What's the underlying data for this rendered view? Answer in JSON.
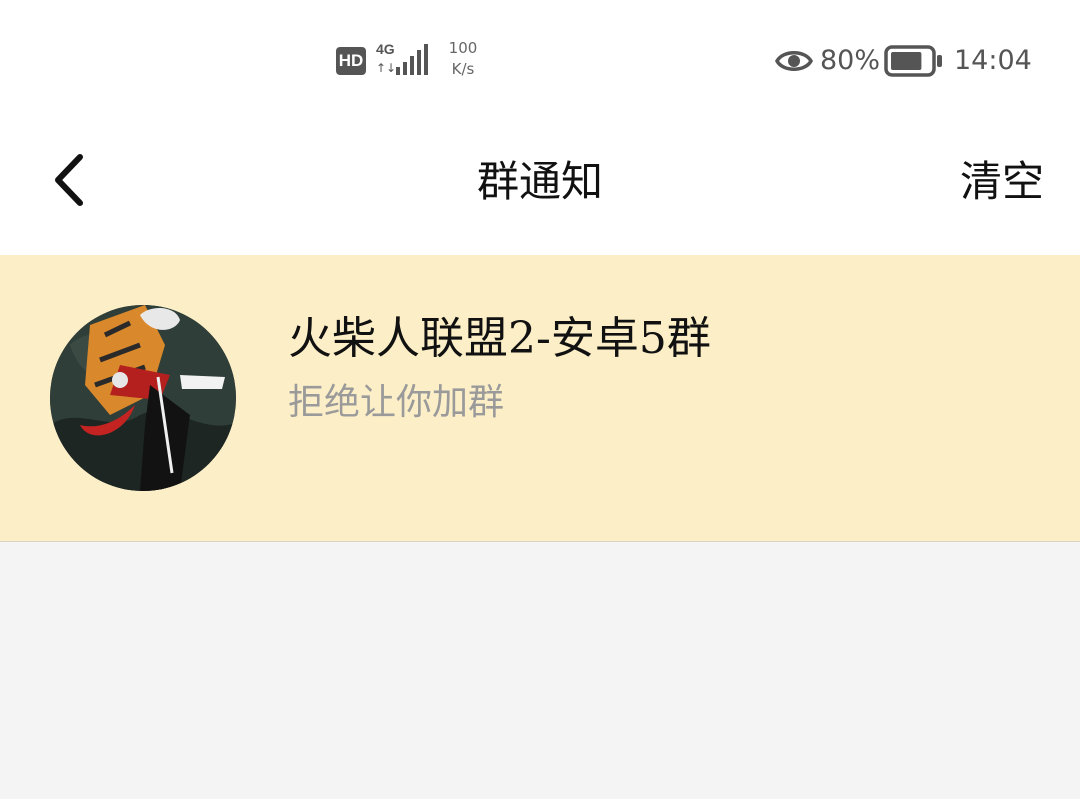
{
  "status_bar": {
    "hd_badge": "HD",
    "network_type": "4G",
    "net_arrows": "↑↓",
    "net_speed_value": "100",
    "net_speed_unit": "K/s",
    "eye_icon": "eye-icon",
    "battery_percent": "80%",
    "battery_level": 0.8,
    "time": "14:04"
  },
  "header": {
    "back_icon": "chevron-left-icon",
    "title": "群通知",
    "clear_label": "清空"
  },
  "notifications": [
    {
      "avatar_icon": "group-avatar",
      "group_name": "火柴人联盟2-安卓5群",
      "message": "拒绝让你加群"
    }
  ],
  "colors": {
    "status_bar_bg": "#ffffff",
    "header_bg": "#ffffff",
    "item_highlight_bg": "#fcefc7",
    "page_bg": "#f4f4f4",
    "primary_text": "#111111",
    "secondary_text": "#9a9a9a"
  }
}
